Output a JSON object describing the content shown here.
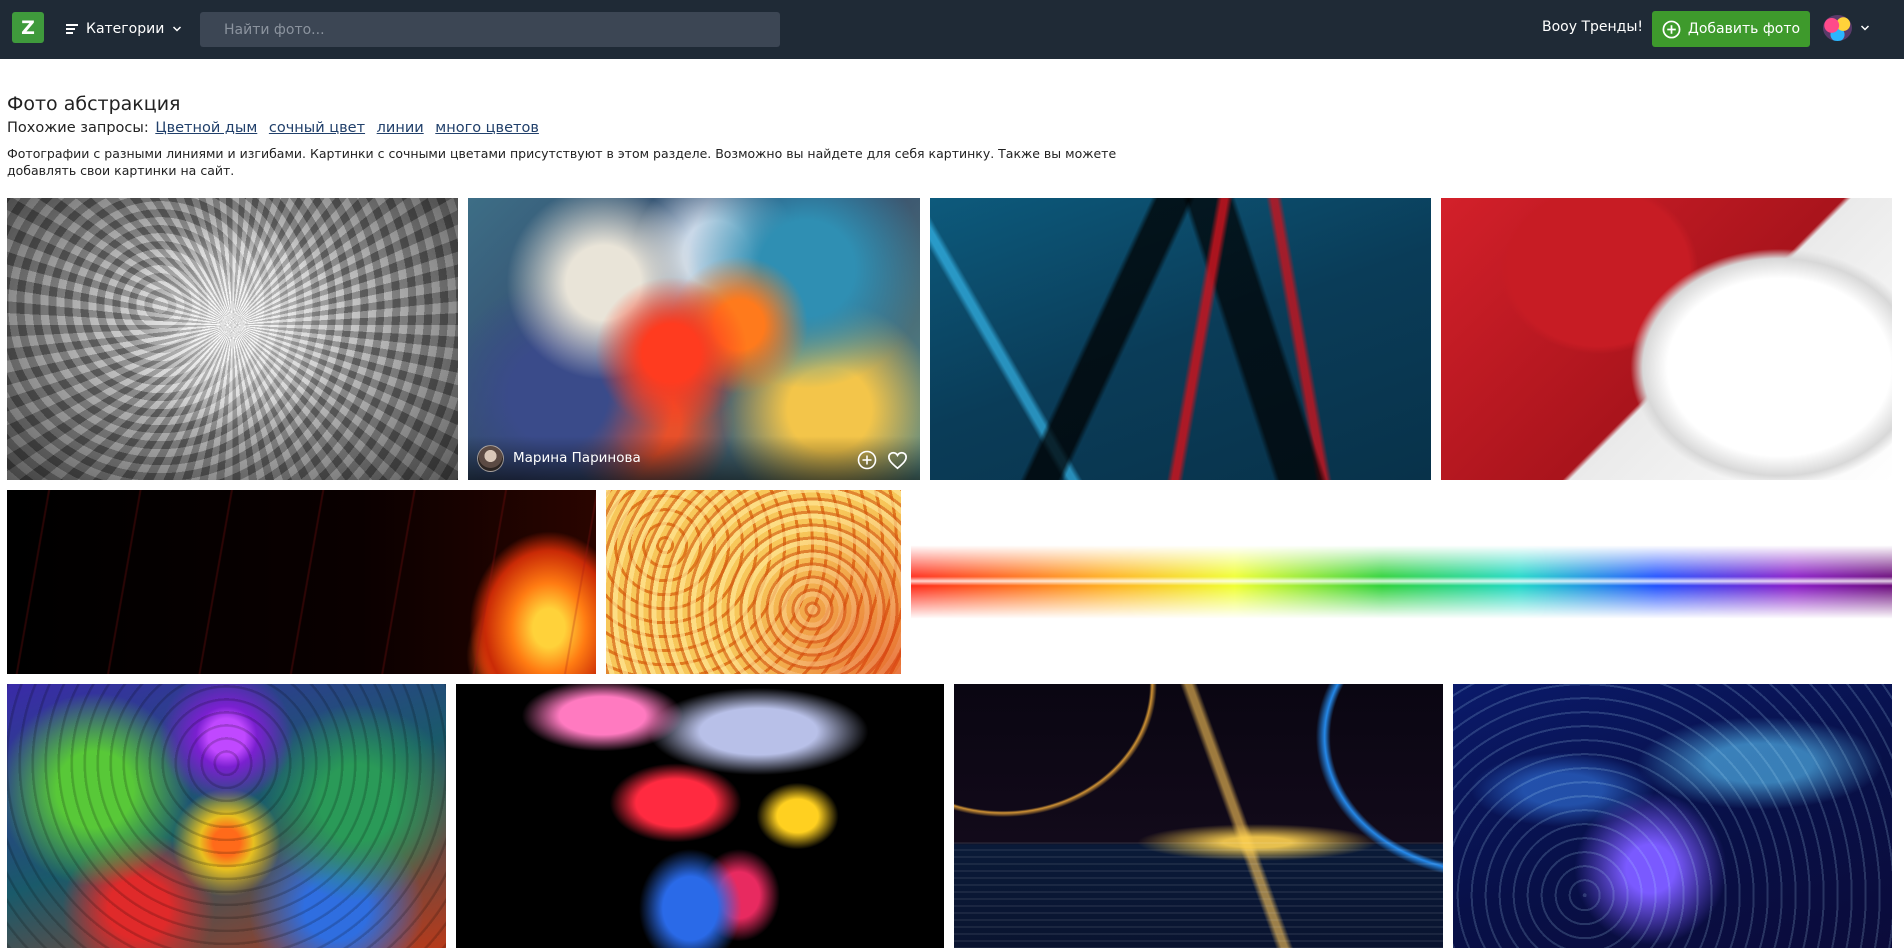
{
  "header": {
    "logo_text": "Z",
    "categories_label": "Категории",
    "search_placeholder": "Найти фото...",
    "trends_label": "Вооу Тренды!",
    "add_photo_label": "Добавить фото",
    "colors": {
      "bar": "#1f2a36",
      "accent": "#3e9a2c"
    }
  },
  "page": {
    "title": "Фото абстракция",
    "related_label": "Похожие запросы:",
    "related_links": [
      "Цветной дым",
      "сочный цвет",
      "линии",
      "много цветов"
    ],
    "description": "Фотографии с разными линиями и изгибами. Картинки с сочными цветами присутствуют в этом разделе. Возможно вы найдете для себя картинку. Также вы можете добавлять свои картинки на сайт."
  },
  "gallery": {
    "photos": [
      {
        "name": "grey-spiral-rays"
      },
      {
        "name": "colorful-paint-explosion",
        "author": "Марина Паринова"
      },
      {
        "name": "blue-red-3d-lines"
      },
      {
        "name": "red-white-wave"
      },
      {
        "name": "fire-and-red-threads"
      },
      {
        "name": "orange-swirls"
      },
      {
        "name": "rainbow-light-line"
      },
      {
        "name": "psychedelic-fractal"
      },
      {
        "name": "colored-smoke-cloud"
      },
      {
        "name": "golden-light-arcs-water"
      },
      {
        "name": "blue-sparkle-feathers"
      }
    ]
  },
  "icons": {
    "menu": "menu-icon",
    "chevron": "chevron-down-icon",
    "add": "plus-circle-icon",
    "like": "heart-icon"
  }
}
